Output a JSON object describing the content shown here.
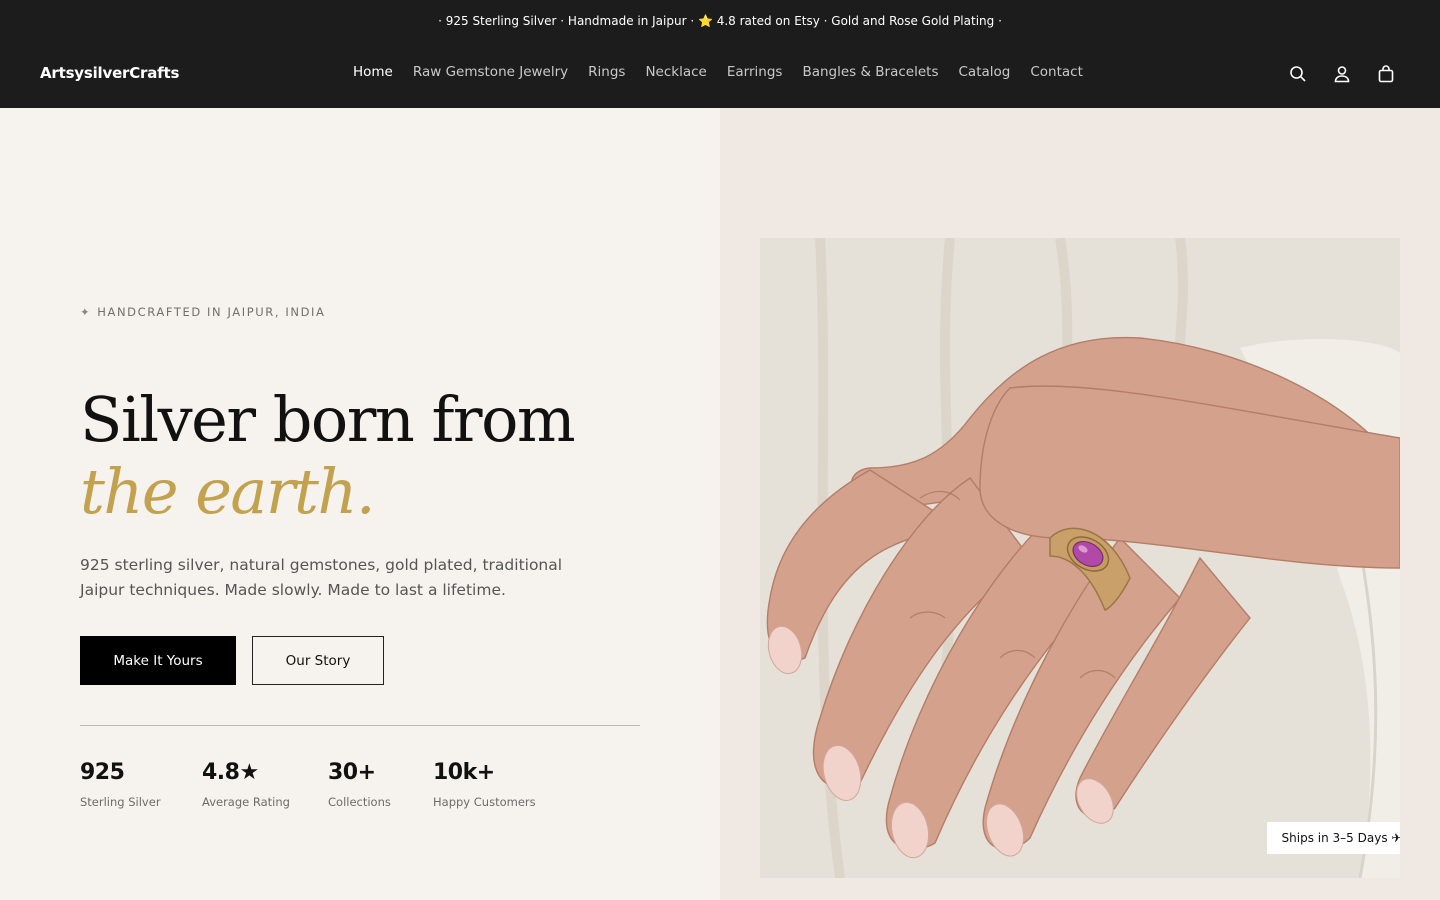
{
  "announcement": "· 925 Sterling Silver · Handmade in Jaipur · ⭐ 4.8 rated on Etsy · Gold and Rose Gold Plating ·",
  "brand": "ArtsysilverCrafts",
  "nav": [
    "Home",
    "Raw Gemstone Jewelry",
    "Rings",
    "Necklace",
    "Earrings",
    "Bangles & Bracelets",
    "Catalog",
    "Contact"
  ],
  "header_icons": [
    "search-icon",
    "account-icon",
    "cart-icon"
  ],
  "hero": {
    "eyebrow_icon": "✦",
    "eyebrow": "HANDCRAFTED IN JAIPUR, INDIA",
    "headline_plain": "Silver born from ",
    "headline_accent": "the earth.",
    "subtext": "925 sterling silver, natural gemstones, gold plated, traditional Jaipur techniques. Made slowly. Made to last a lifetime.",
    "primary_cta": "Make It Yours",
    "secondary_cta": "Our Story"
  },
  "stats": [
    {
      "value": "925",
      "label": "Sterling Silver"
    },
    {
      "value": "4.8★",
      "label": "Average Rating"
    },
    {
      "value": "30+",
      "label": "Collections"
    },
    {
      "value": "10k+",
      "label": "Happy Customers"
    }
  ],
  "image_badge": "Ships in 3–5 Days ✈",
  "colors": {
    "header_bg": "#1c1c1c",
    "accent_gold": "#c2a14f",
    "left_bg": "#f6f3ef",
    "right_bg": "#f0e8e2",
    "gem": "#b04aa6"
  }
}
